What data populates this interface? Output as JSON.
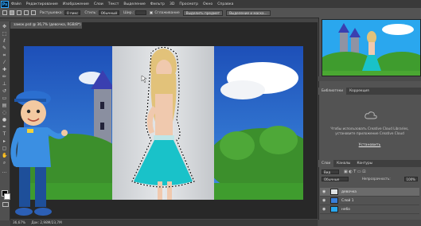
{
  "app": {
    "logo": "Ps"
  },
  "menubar": {
    "items": [
      "Файл",
      "Редактирование",
      "Изображение",
      "Слои",
      "Текст",
      "Выделение",
      "Фильтр",
      "3D",
      "Просмотр",
      "Окно",
      "Справка"
    ]
  },
  "options": {
    "style_label": "Растушевка:",
    "style_value": "0 пикс",
    "mode_label": "Стиль:",
    "mode_value": "Обычный",
    "width_label": "Шир.:",
    "antialias_label": "Сглаживание",
    "select_subject_button": "Выделить предмет",
    "refine_button": "Выделение и маска..."
  },
  "document": {
    "tab_title": "замок.psd @ 36,7% (девочка, RGB/8*)",
    "zoom_status": "36,67%",
    "doc_status": "Док: 2,98M/23,7M"
  },
  "panels": {
    "libraries_tab": "Библиотеки",
    "adjustments_tab": "Коррекция",
    "libraries_message": "Чтобы использовать Creative Cloud Libraries, установите приложение Creative Cloud",
    "install_link": "Установить",
    "layers_tab": "Слои",
    "channels_tab": "Каналы",
    "paths_tab": "Контуры",
    "filter_kind": "Вид",
    "blend_mode": "Обычные",
    "opacity_label": "Непрозрачность:",
    "opacity_value": "100%",
    "fill_label": "Заливка:",
    "fill_value": "100%"
  },
  "layers": [
    {
      "name": "девочка",
      "selected": true
    },
    {
      "name": "Слой 1",
      "selected": false
    },
    {
      "name": "небо",
      "selected": false
    }
  ],
  "colors": {
    "sky": "#2e6ad0",
    "studio": "#dfe1e3",
    "dress": "#19c2c9",
    "grass": "#3f9c2e",
    "accent": "#31a8ff"
  }
}
